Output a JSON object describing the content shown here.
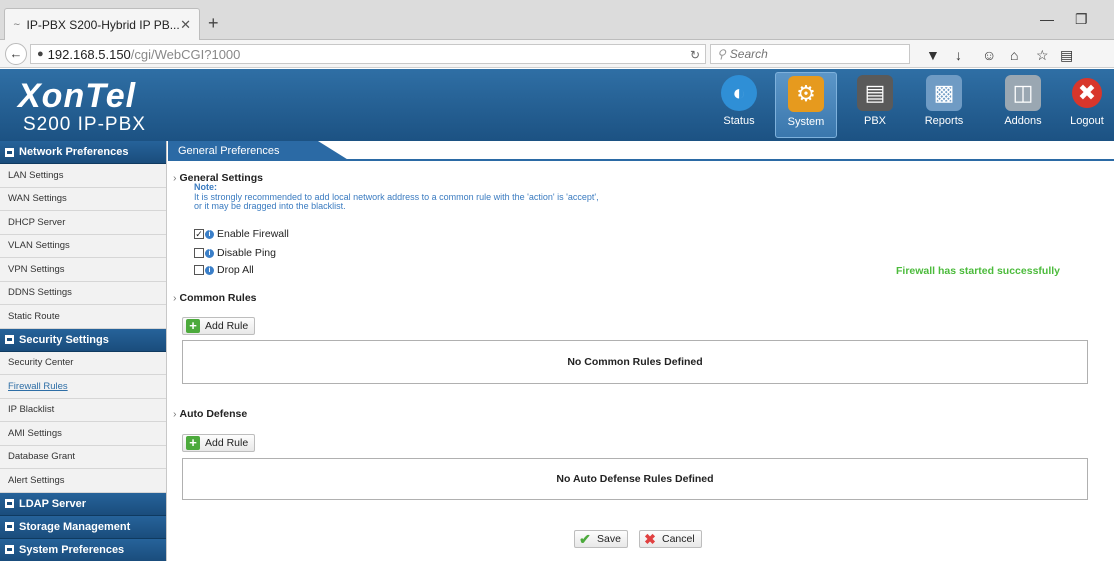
{
  "browser": {
    "tab_title": "IP-PBX S200-Hybrid IP PB...",
    "url_host": "192.168.5.150",
    "url_path": "/cgi/WebCGI?1000",
    "search_placeholder": "Search"
  },
  "header": {
    "brand": "XonTel",
    "model": "S200 IP-PBX",
    "modules": [
      {
        "label": "Status",
        "icon": "status-icon"
      },
      {
        "label": "System",
        "icon": "system-icon",
        "active": true
      },
      {
        "label": "PBX",
        "icon": "pbx-icon"
      },
      {
        "label": "Reports",
        "icon": "reports-icon"
      },
      {
        "label": "Addons",
        "icon": "addons-icon"
      },
      {
        "label": "Logout",
        "icon": "logout-icon"
      }
    ]
  },
  "sidebar": {
    "network_title": "Network Preferences",
    "network_items": [
      "LAN Settings",
      "WAN Settings",
      "DHCP Server",
      "VLAN Settings",
      "VPN Settings",
      "DDNS Settings",
      "Static Route"
    ],
    "security_title": "Security Settings",
    "security_items": [
      "Security Center",
      "Firewall Rules",
      "IP Blacklist",
      "AMI Settings",
      "Database Grant",
      "Alert Settings"
    ],
    "ldap_title": "LDAP Server",
    "storage_title": "Storage Management",
    "sysprefs_title": "System Preferences"
  },
  "content": {
    "title": "General Preferences",
    "general": {
      "heading": "General Settings",
      "note_label": "Note:",
      "note_line1": "It is strongly recommended to add local network address to a common rule with the 'action' is 'accept',",
      "note_line2": "or it may be dragged into the blacklist.",
      "enable_firewall": "Enable Firewall",
      "disable_ping": "Disable Ping",
      "drop_all": "Drop All",
      "status_message": "Firewall has started successfully"
    },
    "common": {
      "heading": "Common Rules",
      "add_label": "Add Rule",
      "empty_message": "No Common Rules Defined"
    },
    "auto_defense": {
      "heading": "Auto Defense",
      "add_label": "Add Rule",
      "empty_message": "No Auto Defense Rules Defined"
    },
    "save_label": "Save",
    "cancel_label": "Cancel"
  }
}
